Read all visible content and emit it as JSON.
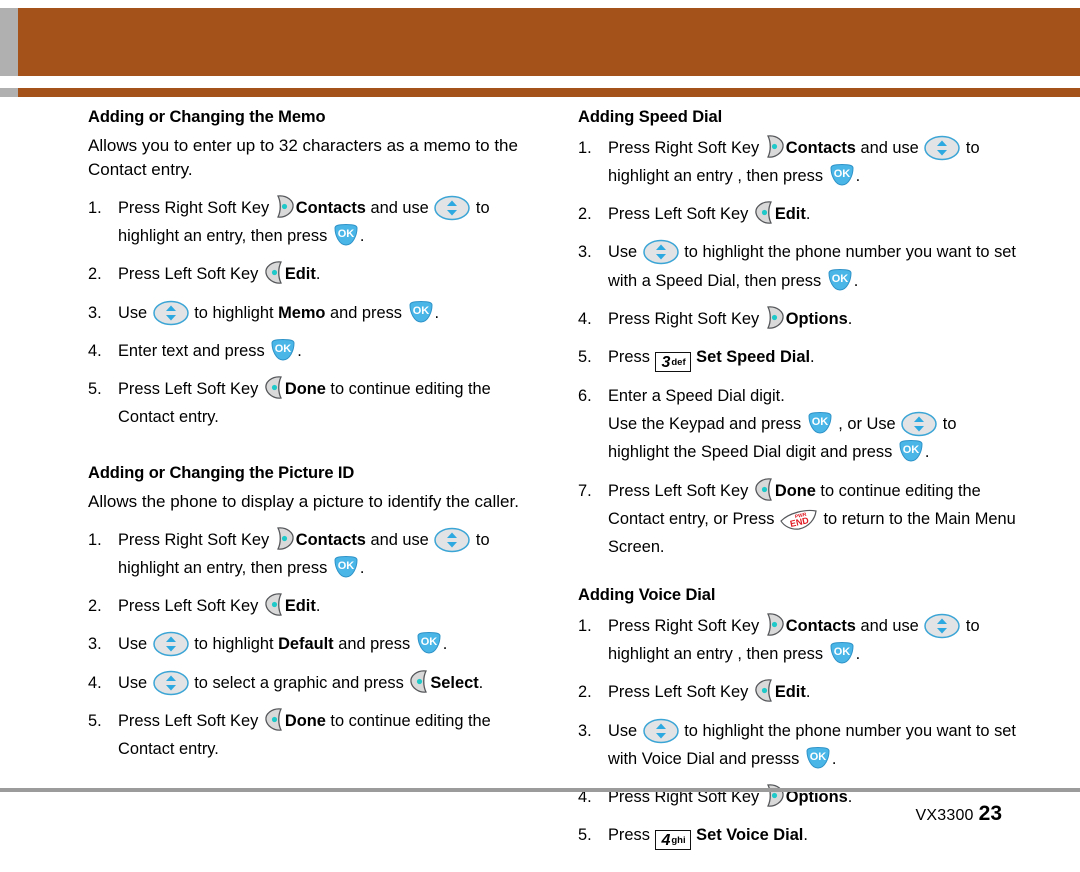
{
  "page": {
    "footer_model": "VX3300",
    "footer_page": "23",
    "header_color": "#a4521a",
    "header_accent_gray": "#b0b0b0"
  },
  "icons": {
    "right_soft_key": "right-soft-key-icon",
    "left_soft_key": "left-soft-key-icon",
    "nav_key": "navigation-up-down-key-icon",
    "ok_key": "ok-key-icon",
    "end_key": "end-key-icon",
    "key_3_digit": "3",
    "key_3_letters": "def",
    "key_4_digit": "4",
    "key_4_letters": "ghi",
    "ok_label": "OK",
    "end_label": "END",
    "end_label_small": "PWR"
  },
  "left_column": {
    "sections": [
      {
        "heading": "Adding or Changing the Memo",
        "intro": "Allows you to enter up to 32 characters as a memo to the Contact entry.",
        "steps": [
          {
            "num": "1.",
            "parts": [
              "Press Right Soft Key ",
              "Contacts",
              " and use ",
              " to highlight an entry, then press ",
              "."
            ]
          },
          {
            "num": "2.",
            "parts": [
              "Press Left Soft Key ",
              "Edit",
              "."
            ]
          },
          {
            "num": "3.",
            "parts": [
              "Use ",
              " to highlight ",
              "Memo",
              " and press ",
              "."
            ]
          },
          {
            "num": "4.",
            "parts": [
              "Enter text and press ",
              "."
            ]
          },
          {
            "num": "5.",
            "parts": [
              "Press Left Soft Key ",
              "Done",
              " to continue editing the Contact entry."
            ]
          }
        ]
      },
      {
        "heading": "Adding or Changing the Picture ID",
        "intro": "Allows the phone to display a picture to identify the caller.",
        "steps": [
          {
            "num": "1.",
            "parts": [
              "Press Right Soft Key ",
              "Contacts",
              " and use ",
              " to highlight an entry, then press ",
              "."
            ]
          },
          {
            "num": "2.",
            "parts": [
              "Press Left Soft Key ",
              "Edit",
              "."
            ]
          },
          {
            "num": "3.",
            "parts": [
              "Use ",
              " to highlight ",
              "Default",
              " and press ",
              "."
            ]
          },
          {
            "num": "4.",
            "parts": [
              "Use ",
              " to select a graphic and press ",
              "Select",
              "."
            ]
          },
          {
            "num": "5.",
            "parts": [
              "Press Left Soft Key ",
              "Done",
              " to continue editing the Contact entry."
            ]
          }
        ]
      }
    ]
  },
  "right_column": {
    "sections": [
      {
        "heading": "Adding Speed Dial",
        "steps": [
          {
            "num": "1.",
            "parts": [
              "Press Right Soft Key ",
              "Contacts",
              " and use ",
              " to highlight an entry , then press ",
              "."
            ]
          },
          {
            "num": "2.",
            "parts": [
              "Press Left Soft Key ",
              "Edit",
              "."
            ]
          },
          {
            "num": "3.",
            "parts": [
              "Use ",
              " to highlight the phone number you want to set with a Speed Dial, then press ",
              "."
            ]
          },
          {
            "num": "4.",
            "parts": [
              "Press Right Soft Key ",
              "Options",
              "."
            ]
          },
          {
            "num": "5.",
            "parts": [
              "Press ",
              "Set Speed Dial",
              "."
            ]
          },
          {
            "num": "6.",
            "parts": [
              "Enter a Speed Dial digit.",
              "Use the Keypad and press ",
              " , or Use ",
              " to highlight the Speed Dial digit and press ",
              "."
            ]
          },
          {
            "num": "7.",
            "parts": [
              "Press Left Soft Key ",
              "Done",
              " to continue editing the Contact entry, or Press ",
              " to return to the Main Menu Screen."
            ]
          }
        ]
      },
      {
        "heading": "Adding Voice Dial",
        "steps": [
          {
            "num": "1.",
            "parts": [
              "Press Right Soft Key ",
              "Contacts",
              " and use ",
              " to highlight an entry , then press ",
              "."
            ]
          },
          {
            "num": "2.",
            "parts": [
              "Press Left Soft Key ",
              "Edit",
              "."
            ]
          },
          {
            "num": "3.",
            "parts": [
              "Use ",
              " to highlight the phone number you want to set with Voice Dial and presss ",
              "."
            ]
          },
          {
            "num": "4.",
            "parts": [
              "Press Right Soft Key ",
              "Options",
              "."
            ]
          },
          {
            "num": "5.",
            "parts": [
              "Press ",
              "Set Voice Dial",
              "."
            ]
          }
        ]
      }
    ]
  },
  "text_fragments": {
    "press_right_soft_key": "Press Right Soft Key ",
    "press_left_soft_key": "Press Left Soft Key ",
    "contacts": "Contacts",
    "and_use": " and use ",
    "to_highlight_entry_then_press": " to highlight an entry, then press ",
    "to_highlight_entry_sp_then_press": " to highlight an entry , then press ",
    "period": ".",
    "edit": "Edit",
    "use": "Use ",
    "to_highlight": " to highlight ",
    "memo": "Memo",
    "default": "Default",
    "and_press": " and press ",
    "enter_text_and_press": "Enter text and press ",
    "done": "Done",
    "to_continue_editing": " to continue editing the Contact entry.",
    "to_select_graphic": " to select a graphic and press ",
    "select": "Select",
    "to_highlight_phone_speed": " to highlight the phone number you want to set with a Speed Dial, then press ",
    "to_highlight_phone_voice": " to highlight the phone number you want to set with Voice Dial and presss ",
    "options": "Options",
    "press": "Press ",
    "set_speed_dial": "Set Speed Dial",
    "set_voice_dial": "Set Voice Dial",
    "enter_speed_dial_digit": "Enter a Speed Dial digit.",
    "use_keypad_and_press": "Use the Keypad and press ",
    "or_use": " , or Use ",
    "to_highlight_sd_digit": " to highlight the Speed Dial digit and press ",
    "to_continue_editing_contact": " to continue editing the Contact entry, or Press ",
    "to_return_main_menu": " to return to the Main Menu Screen."
  }
}
